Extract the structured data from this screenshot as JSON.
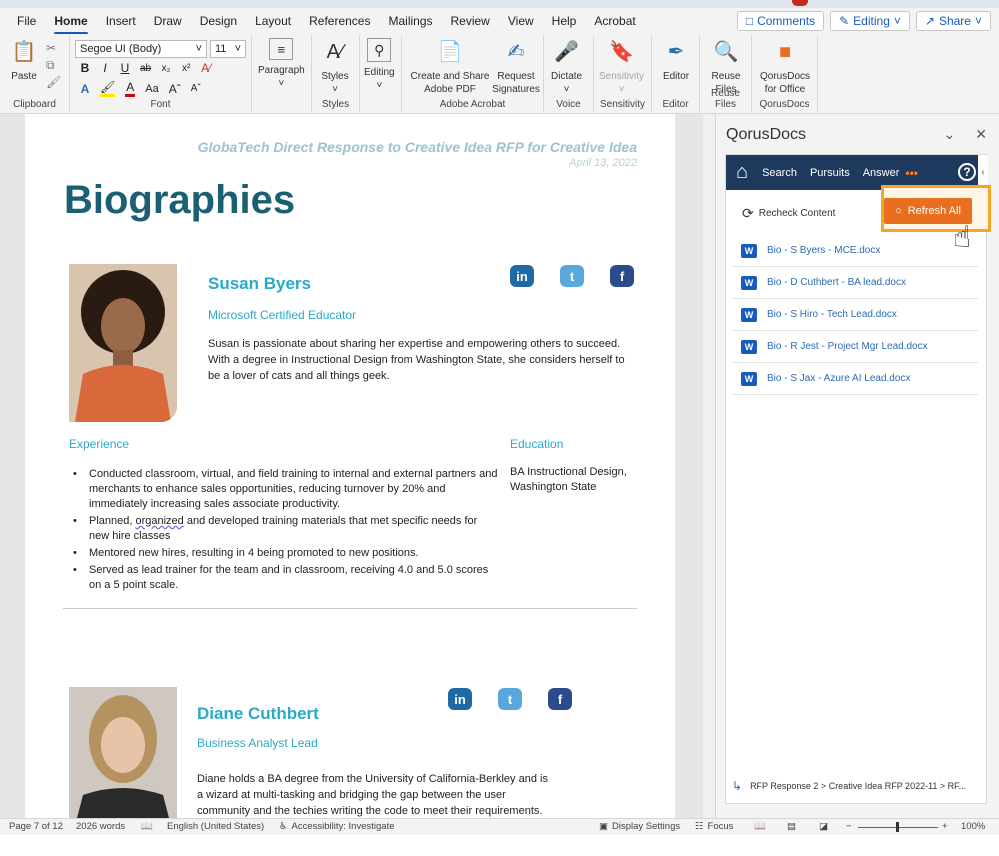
{
  "menubar": {
    "tabs": [
      "File",
      "Home",
      "Insert",
      "Draw",
      "Design",
      "Layout",
      "References",
      "Mailings",
      "Review",
      "View",
      "Help",
      "Acrobat"
    ],
    "active_tab": "Home",
    "comments_label": "Comments",
    "editing_label": "Editing",
    "share_label": "Share"
  },
  "ribbon": {
    "clipboard": {
      "paste_label": "Paste",
      "group_label": "Clipboard"
    },
    "font": {
      "family": "Segoe UI (Body)",
      "size": "11",
      "group_label": "Font"
    },
    "paragraph": {
      "label": "Paragraph"
    },
    "styles": {
      "label": "Styles",
      "group_label": "Styles"
    },
    "editing": {
      "label": "Editing"
    },
    "acrobat": {
      "create_label": "Create and Share Adobe PDF",
      "request_label": "Request Signatures",
      "group_label": "Adobe Acrobat"
    },
    "voice": {
      "dictate_label": "Dictate",
      "group_label": "Voice"
    },
    "sensitivity": {
      "label": "Sensitivity",
      "group_label": "Sensitivity"
    },
    "editor": {
      "label": "Editor",
      "group_label": "Editor"
    },
    "reuse": {
      "label": "Reuse Files",
      "group_label": "Reuse Files"
    },
    "qorus": {
      "label": "QorusDocs for Office",
      "group_label": "QorusDocs"
    }
  },
  "document": {
    "header_title": "GlobaTech Direct Response to Creative Idea RFP for Creative Idea",
    "header_date": "April 13, 2022",
    "page_title": "Biographies",
    "person1": {
      "name": "Susan Byers",
      "role": "Microsoft Certified Educator",
      "bio": "Susan is passionate about sharing her expertise and empowering others to succeed. With a degree in Instructional Design from Washington State, she considers herself to be a lover of cats and all things geek.",
      "experience_heading": "Experience",
      "education_heading": "Education",
      "education_text": "BA Instructional Design, Washington State",
      "bullets": [
        "Conducted classroom, virtual, and field training to internal and external partners and merchants to enhance sales opportunities, reducing turnover by 20% and immediately increasing sales associate productivity.",
        "Planned, organized and developed training materials that met specific needs for new hire classes",
        "Mentored new hires, resulting in 4 being promoted to new positions.",
        "Served as lead trainer for the team and in classroom, receiving 4.0 and 5.0 scores on a 5 point scale."
      ]
    },
    "person2": {
      "name": "Diane Cuthbert",
      "role": "Business Analyst Lead",
      "bio": "Diane holds a BA degree from the University of California-Berkley and is a wizard at multi-tasking and bridging the gap between the user community and the techies writing the code to meet their requirements."
    },
    "social": {
      "linkedin": "in",
      "twitter": "t",
      "facebook": "f"
    }
  },
  "pane": {
    "title": "QorusDocs",
    "nav": {
      "search": "Search",
      "pursuits": "Pursuits",
      "answer": "Answer",
      "more": "•••",
      "help": "?"
    },
    "recheck_label": "Recheck Content",
    "refresh_label": "Refresh All",
    "files": [
      "Bio - S Byers - MCE.docx",
      "Bio - D Cuthbert - BA lead.docx",
      "Bio - S Hiro - Tech Lead.docx",
      "Bio - R Jest - Project Mgr Lead.docx",
      "Bio - S Jax - Azure AI Lead.docx"
    ],
    "breadcrumb": "RFP Response 2 > Creative Idea RFP 2022-11 > RF..."
  },
  "statusbar": {
    "page": "Page 7 of 12",
    "words": "2026 words",
    "language": "English (United States)",
    "accessibility": "Accessibility: Investigate",
    "display_settings": "Display Settings",
    "focus": "Focus",
    "zoom": "100%"
  },
  "colors": {
    "accent_blue": "#185abd",
    "teal_title": "#1b5f72",
    "cyan_heading": "#2aa9c9",
    "qorus_nav": "#1e3a5f",
    "refresh_orange": "#e86f1f",
    "highlight_frame": "#f5a623"
  }
}
